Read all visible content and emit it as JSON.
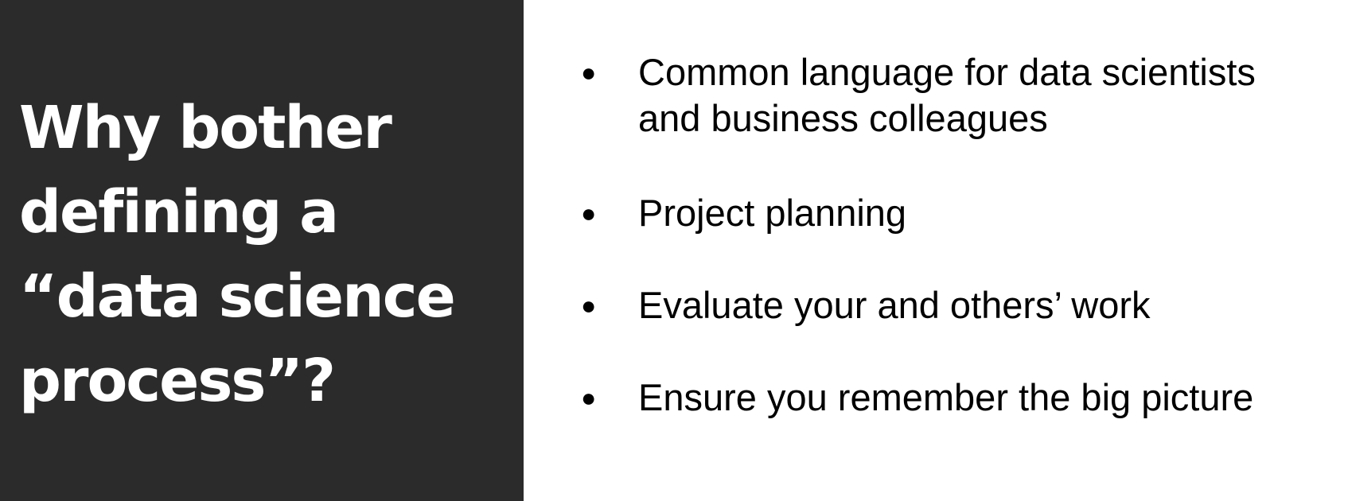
{
  "title_lines": [
    "Why bother",
    "defining a",
    "“data science",
    "process”?"
  ],
  "bullet_symbol": "●",
  "bullets": [
    {
      "lines": [
        "Common language for data scientists",
        "and business colleagues"
      ]
    },
    {
      "lines": [
        "Project planning"
      ]
    },
    {
      "lines": [
        "Evaluate your and others’ work"
      ]
    },
    {
      "lines": [
        "Ensure you remember the big picture"
      ]
    }
  ],
  "colors": {
    "left_panel_bg": "#2b2b2b",
    "title_text": "#ffffff",
    "right_panel_bg": "#ffffff",
    "bullet_text": "#000000"
  }
}
